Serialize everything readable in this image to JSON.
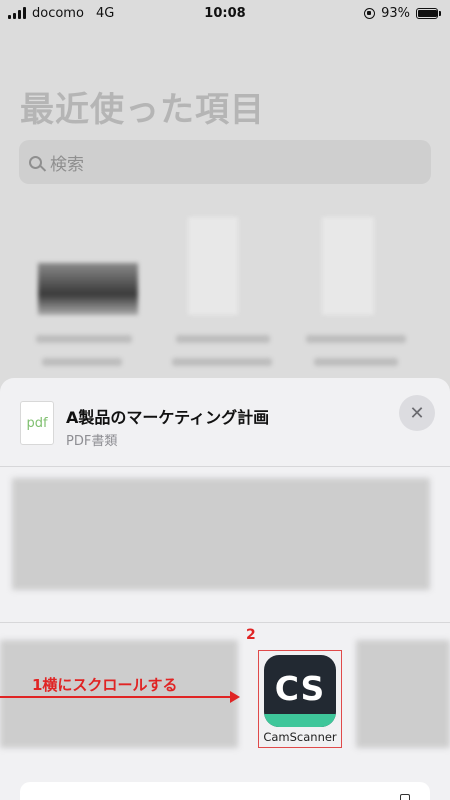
{
  "status_bar": {
    "carrier": "docomo",
    "network": "4G",
    "time": "10:08",
    "battery": "93%",
    "battery_level": 0.93
  },
  "background": {
    "title": "最近使った項目",
    "search_placeholder": "検索"
  },
  "share_sheet": {
    "file_icon_text": "pdf",
    "file_title": "A製品のマーケティング計画",
    "file_type": "PDF書類",
    "close_glyph": "✕",
    "apps": [
      {
        "name": "CamScanner",
        "icon_text": "CS"
      }
    ],
    "colors": {
      "camscanner_dark": "#222932",
      "camscanner_green": "#3ec69a",
      "annotation": "#e02424"
    }
  },
  "annotations": {
    "step_number": "2",
    "scroll_instruction": "1横にスクロールする"
  }
}
